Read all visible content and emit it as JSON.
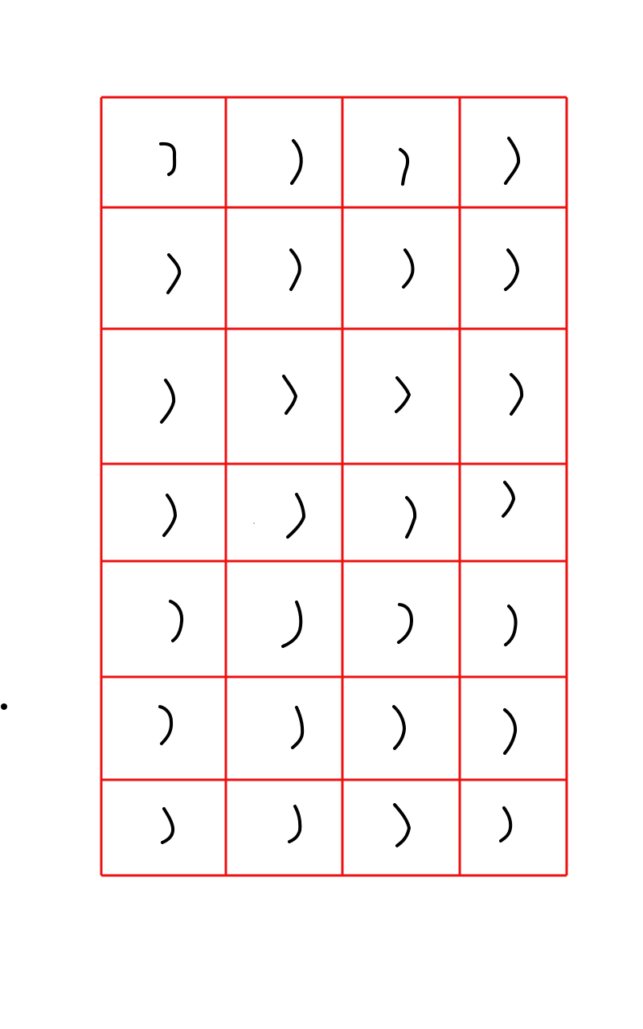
{
  "canvas": {
    "background": "#ffffff",
    "grid_color": "#ee1111",
    "stroke_color": "#000000"
  },
  "grid": {
    "rows": 7,
    "columns": 4,
    "cell_glyph": ")",
    "cell_glyph_count": 28
  },
  "margin_mark": {
    "shape": "dot",
    "present": true
  }
}
